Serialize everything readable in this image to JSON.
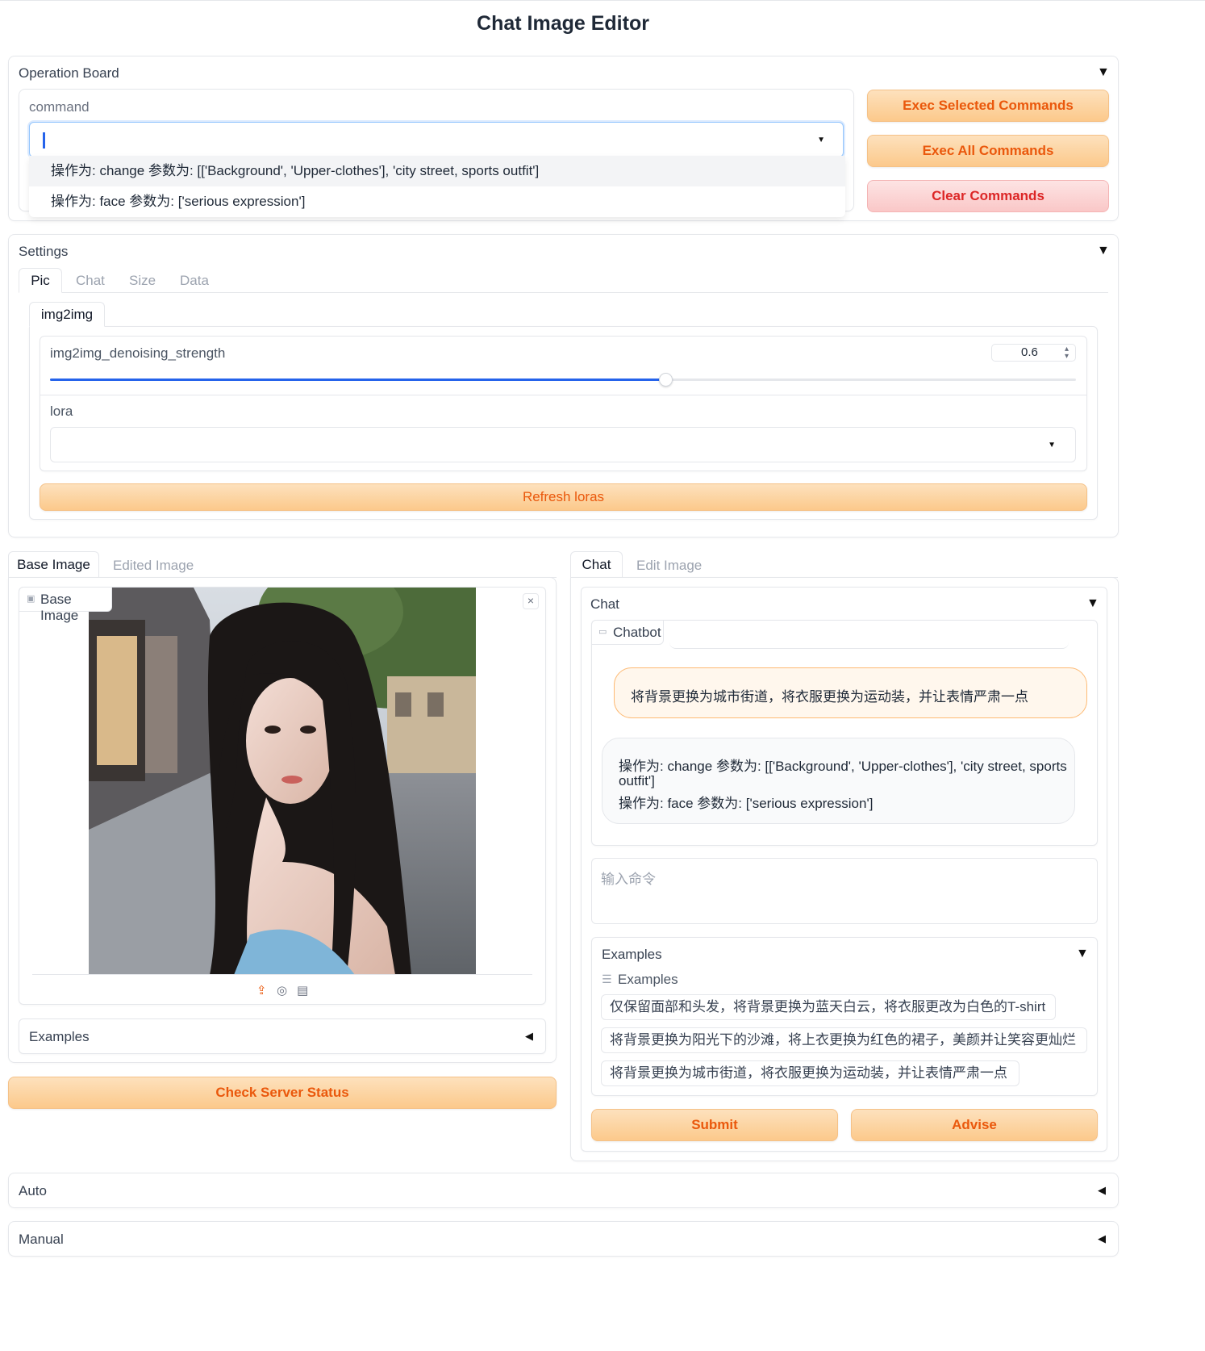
{
  "app": {
    "title": "Chat Image Editor"
  },
  "operation_board": {
    "title": "Operation Board",
    "command_label": "command",
    "dropdown_options": [
      "操作为: change 参数为: [['Background', 'Upper-clothes'], 'city street, sports outfit']",
      "操作为: face 参数为: ['serious expression']"
    ],
    "exec_selected": "Exec Selected Commands",
    "exec_all": "Exec All Commands",
    "clear": "Clear Commands"
  },
  "settings": {
    "title": "Settings",
    "tabs": [
      "Pic",
      "Chat",
      "Size",
      "Data"
    ],
    "subtab": "img2img",
    "denoise_label": "img2img_denoising_strength",
    "denoise_value": "0.6",
    "denoise_fraction": 0.6,
    "lora_label": "lora",
    "refresh_loras": "Refresh loras"
  },
  "left": {
    "tabs": [
      "Base Image",
      "Edited Image"
    ],
    "image_label": "Base Image",
    "examples_label": "Examples",
    "check_server": "Check Server Status"
  },
  "right": {
    "tabs": [
      "Chat",
      "Edit Image"
    ],
    "chat_title": "Chat",
    "chatbot_label": "Chatbot",
    "user_message": "将背景更换为城市街道，将衣服更换为运动装，并让表情严肃一点",
    "bot_message_line1": "操作为: change 参数为: [['Background', 'Upper-clothes'], 'city street, sports",
    "bot_message_line2": "outfit']",
    "bot_message_line3": "操作为: face 参数为: ['serious expression']",
    "input_placeholder": "输入命令",
    "examples_title": "Examples",
    "examples_sub": "Examples",
    "examples": [
      "仅保留面部和头发，将背景更换为蓝天白云，将衣服更改为白色的T-shirt",
      "将背景更换为阳光下的沙滩，将上衣更换为红色的裙子，美颜并让笑容更灿烂",
      "将背景更换为城市街道，将衣服更换为运动装，并让表情严肃一点"
    ],
    "submit": "Submit",
    "advise": "Advise"
  },
  "bottom": {
    "auto": "Auto",
    "manual": "Manual"
  },
  "colors": {
    "accent": "#ea580c",
    "slider": "#2563eb",
    "danger": "#dc2626"
  }
}
